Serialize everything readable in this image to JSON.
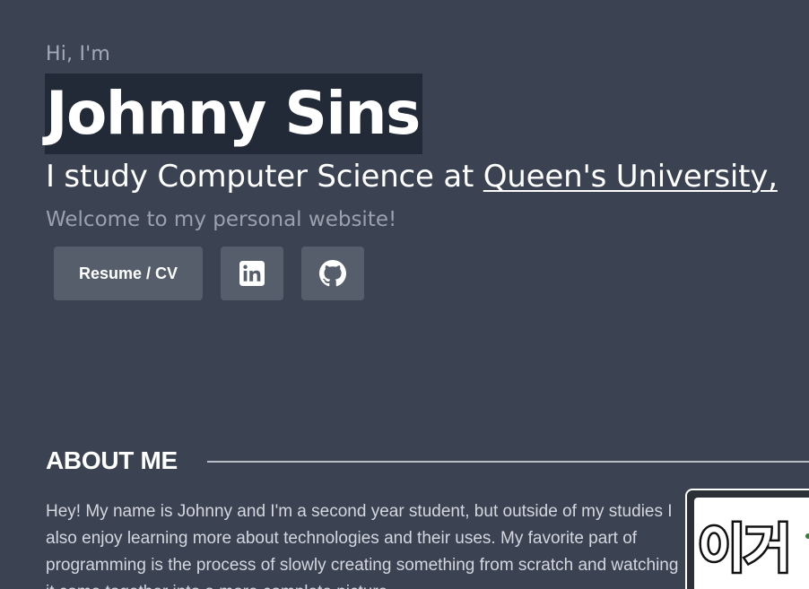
{
  "hero": {
    "greeting": "Hi, I'm",
    "name": "Johnny Sins",
    "study_prefix": "I study Computer Science at ",
    "university_link": "Queen's University,",
    "welcome": "Welcome to my personal website!"
  },
  "buttons": {
    "resume_label": "Resume / CV",
    "linkedin_icon": "linkedin-icon",
    "github_icon": "github-icon"
  },
  "about": {
    "heading": "ABOUT ME",
    "text": "Hey! My name is Johnny and I'm a second year student, but outside of my studies I also enjoy learning more about technologies and their uses. My favorite part of programming is the process of slowly creating something from scratch and watching it come together into a more complete picture.",
    "photo_caption": "이거"
  },
  "colors": {
    "background": "#3b4252",
    "name_highlight": "#222a38",
    "button_bg": "#575e6b"
  }
}
